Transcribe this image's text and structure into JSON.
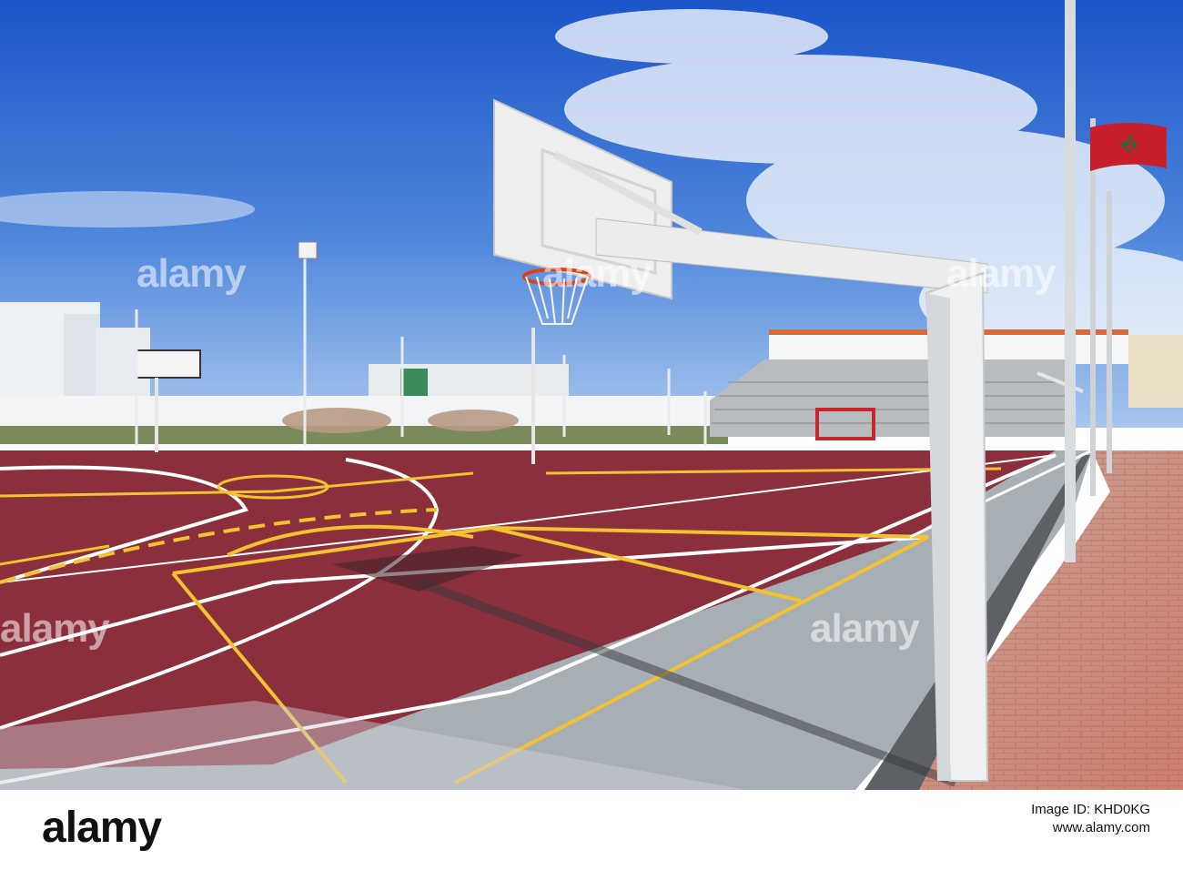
{
  "image": {
    "description_colors": {
      "sky_top": "#1f5fd0",
      "sky_bottom": "#8fb6ea",
      "court_red": "#8e2f3d",
      "court_grey": "#a9b0b5",
      "line_yellow": "#f2c230",
      "line_white": "#ffffff",
      "pavers": "#cf8f80",
      "flag_red": "#c8202a"
    }
  },
  "watermark": {
    "text": "alamy"
  },
  "footer": {
    "logo": "alamy",
    "image_id_label": "Image ID: KHD0KG",
    "site": "www.alamy.com"
  }
}
